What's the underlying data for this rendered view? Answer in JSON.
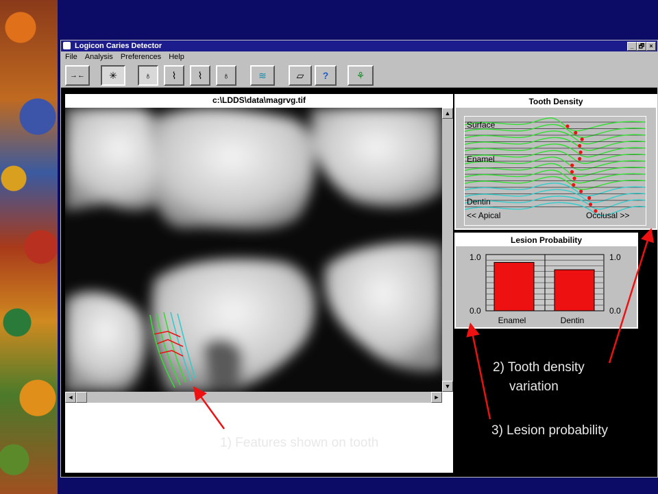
{
  "window": {
    "title": "Logicon Caries Detector",
    "buttons": [
      "_",
      "🗗",
      "×"
    ]
  },
  "menu": [
    "File",
    "Analysis",
    "Preferences",
    "Help"
  ],
  "toolbar": [
    {
      "name": "back-arrows-icon",
      "glyph": "→←"
    },
    {
      "name": "starburst-icon",
      "glyph": "✳"
    },
    {
      "name": "molar-tooth-icon",
      "glyph": "♁"
    },
    {
      "name": "incisor-tooth-icon",
      "glyph": "⌇"
    },
    {
      "name": "canine-tooth-icon",
      "glyph": "⌇"
    },
    {
      "name": "premolar-tooth-icon",
      "glyph": "♁"
    },
    {
      "name": "density-lines-icon",
      "glyph": "≋"
    },
    {
      "name": "eraser-icon",
      "glyph": "▱"
    },
    {
      "name": "help-icon",
      "glyph": "?"
    },
    {
      "name": "plant-icon",
      "glyph": "⚘"
    }
  ],
  "image_pane": {
    "title": "c:\\LDDS\\data\\magrvg.tif"
  },
  "density": {
    "title": "Tooth Density",
    "labels": {
      "surface": "Surface",
      "enamel": "Enamel",
      "dentin": "Dentin",
      "apical": "<< Apical",
      "occlusal": "Occlusal >>"
    }
  },
  "lesion": {
    "title": "Lesion Probability",
    "y_top": "1.0",
    "y_bottom": "0.0",
    "bars": [
      {
        "label": "Enamel",
        "value": 0.86
      },
      {
        "label": "Dentin",
        "value": 0.73
      }
    ]
  },
  "annotations": {
    "features": "1) Features shown on tooth",
    "density_line1": "2) Tooth density",
    "density_line2": "variation",
    "lesion": "3) Lesion probability"
  },
  "colors": {
    "green": "#33dd33",
    "cyan": "#33cccc",
    "red": "#ee1111"
  }
}
